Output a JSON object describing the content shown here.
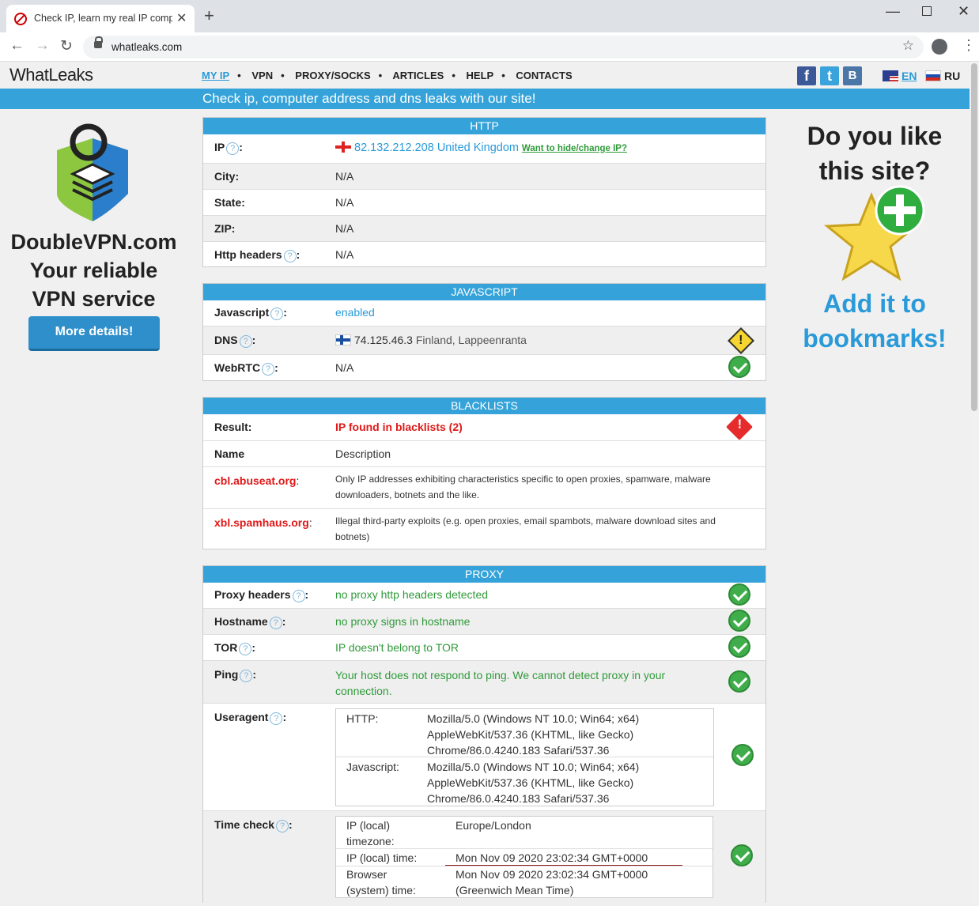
{
  "browser": {
    "tab_title": "Check IP, learn my real IP compu",
    "url": "whatleaks.com"
  },
  "site": {
    "logo": "WhatLeaks",
    "nav": [
      "MY IP",
      "VPN",
      "PROXY/SOCKS",
      "ARTICLES",
      "HELP",
      "CONTACTS"
    ],
    "lang_en": "EN",
    "lang_ru": "RU",
    "banner": "Check ip, computer address and dns leaks with our site!"
  },
  "left_ad": {
    "line1": "DoubleVPN.com",
    "line2": "Your reliable",
    "line3": "VPN service",
    "button": "More details!"
  },
  "right_ad": {
    "line1": "Do you like",
    "line2": "this site?",
    "line3": "Add it to",
    "line4": "bookmarks!"
  },
  "http": {
    "header": "HTTP",
    "ip_label": "IP",
    "ip_value": "82.132.212.208 United Kingdom",
    "ip_link": "Want to hide/change IP?",
    "city_label": "City:",
    "city_value": "N/A",
    "state_label": "State:",
    "state_value": "N/A",
    "zip_label": "ZIP:",
    "zip_value": "N/A",
    "headers_label": "Http headers",
    "headers_value": "N/A"
  },
  "javascript": {
    "header": "JAVASCRIPT",
    "js_label": "Javascript",
    "js_value": "enabled",
    "dns_label": "DNS",
    "dns_ip": "74.125.46.3",
    "dns_loc": "Finland, Lappeenranta",
    "webrtc_label": "WebRTC",
    "webrtc_value": "N/A"
  },
  "blacklists": {
    "header": "BLACKLISTS",
    "result_label": "Result:",
    "result_value": "IP found in blacklists (2)",
    "name_col": "Name",
    "desc_col": "Description",
    "items": [
      {
        "name": "cbl.abuseat.org",
        "desc_1": "Only IP addresses exhibiting characteristics specific to open proxies, spamware, malware",
        "desc_2": "downloaders, botnets and the like."
      },
      {
        "name": "xbl.spamhaus.org",
        "desc_1": "Illegal third-party exploits (e.g. open proxies, email spambots, malware download sites and",
        "desc_2": "botnets)"
      }
    ]
  },
  "proxy": {
    "header": "PROXY",
    "ph_label": "Proxy headers",
    "ph_value": "no proxy http headers detected",
    "host_label": "Hostname",
    "host_value": "no proxy signs in hostname",
    "tor_label": "TOR",
    "tor_value": "IP doesn't belong to TOR",
    "ping_label": "Ping",
    "ping_value_1": "Your host does not respond to ping. We cannot detect proxy in your",
    "ping_value_2": "connection.",
    "ua_label": "Useragent",
    "ua_http_key": "HTTP:",
    "ua_http_1": "Mozilla/5.0 (Windows NT 10.0; Win64; x64)",
    "ua_http_2": "AppleWebKit/537.36 (KHTML, like Gecko)",
    "ua_http_3": "Chrome/86.0.4240.183 Safari/537.36",
    "ua_js_key": "Javascript:",
    "ua_js_1": "Mozilla/5.0 (Windows NT 10.0; Win64; x64)",
    "ua_js_2": "AppleWebKit/537.36 (KHTML, like Gecko)",
    "ua_js_3": "Chrome/86.0.4240.183 Safari/537.36",
    "time_label": "Time check",
    "tz_key_1": "IP (local)",
    "tz_key_2": "timezone:",
    "tz_value": "Europe/London",
    "iptime_key": "IP (local) time:",
    "iptime_value": "Mon Nov 09 2020 23:02:34 GMT+0000",
    "btime_key_1": "Browser",
    "btime_key_2": "(system) time:",
    "btime_value_1": "Mon Nov 09 2020 23:02:34 GMT+0000",
    "btime_value_2": "(Greenwich Mean Time)"
  },
  "colors": {
    "accent": "#35a3d9",
    "ok": "#3fae4a",
    "error": "#e52b2b",
    "warn": "#f6d530"
  }
}
